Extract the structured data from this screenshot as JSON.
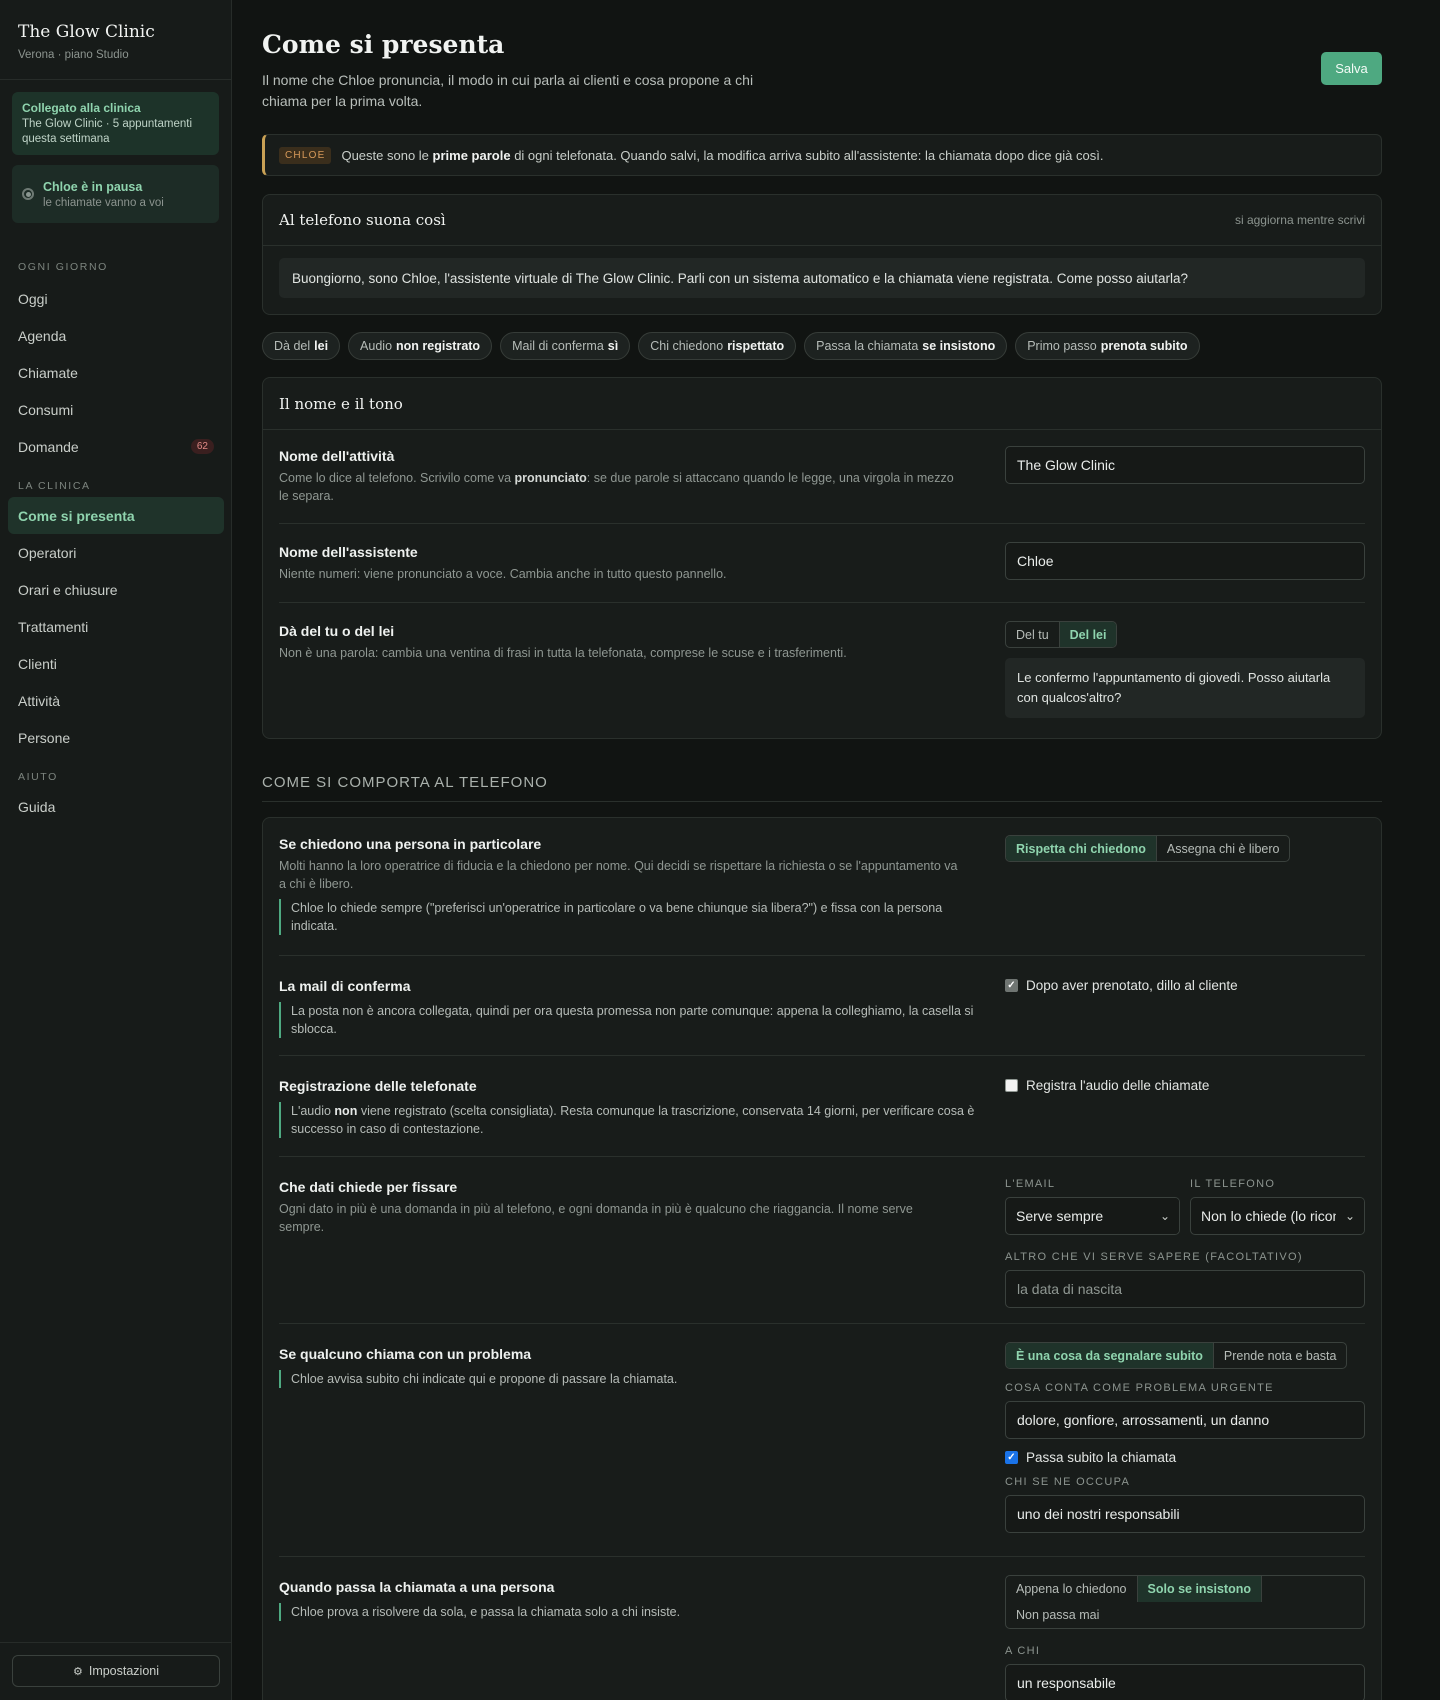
{
  "sidebar": {
    "brand": "The Glow Clinic",
    "location": "Verona · piano Studio",
    "connected": {
      "title": "Collegato alla clinica",
      "text": "The Glow Clinic · 5 appuntamenti questa settimana"
    },
    "pause": {
      "title": "Chloe è in pausa",
      "text": "le chiamate vanno a voi"
    },
    "sections": [
      {
        "label": "Ogni giorno",
        "items": [
          "Oggi",
          "Agenda",
          "Chiamate",
          "Consumi",
          "Domande"
        ]
      },
      {
        "label": "La clinica",
        "items": [
          "Come si presenta",
          "Operatori",
          "Orari e chiusure",
          "Trattamenti",
          "Clienti",
          "Attività",
          "Persone"
        ]
      },
      {
        "label": "Aiuto",
        "items": [
          "Guida"
        ]
      }
    ],
    "domande_badge": "62",
    "settings": "Impostazioni"
  },
  "header": {
    "title": "Come si presenta",
    "subtitle": "Il nome che Chloe pronuncia, il modo in cui parla ai clienti e cosa propone a chi chiama per la prima volta.",
    "save": "Salva"
  },
  "notice": {
    "tag": "CHLOE",
    "pre": "Queste sono le",
    "bold": "prime parole",
    "post": "di ogni telefonata. Quando salvi, la modifica arriva subito all'assistente: la chiamata dopo dice già così."
  },
  "preview": {
    "title": "Al telefono suona così",
    "note": "si aggiorna mentre scrivi",
    "greeting": "Buongiorno, sono Chloe, l'assistente virtuale di The Glow Clinic. Parli con un sistema automatico e la chiamata viene registrata. Come posso aiutarla?"
  },
  "chips": [
    {
      "k": "Dà del",
      "v": "lei"
    },
    {
      "k": "Audio",
      "v": "non registrato"
    },
    {
      "k": "Mail di conferma",
      "v": "sì"
    },
    {
      "k": "Chi chiedono",
      "v": "rispettato"
    },
    {
      "k": "Passa la chiamata",
      "v": "se insistono"
    },
    {
      "k": "Primo passo",
      "v": "prenota subito"
    }
  ],
  "name_panel": {
    "title": "Il nome e il tono",
    "business": {
      "label": "Nome dell'attività",
      "desc_pre": "Come lo dice al telefono. Scrivilo come va",
      "desc_bold": "pronunciato",
      "desc_post": ": se due parole si attaccano quando le legge, una virgola in mezzo le separa.",
      "value": "The Glow Clinic"
    },
    "assistant": {
      "label": "Nome dell'assistente",
      "desc": "Niente numeri: viene pronunciato a voce. Cambia anche in tutto questo pannello.",
      "value": "Chloe"
    },
    "tone": {
      "label": "Dà del tu o del lei",
      "desc": "Non è una parola: cambia una ventina di frasi in tutta la telefonata, comprese le scuse e i trasferimenti.",
      "options": [
        "Del tu",
        "Del lei"
      ],
      "example": "Le confermo l'appuntamento di giovedì. Posso aiutarla con qualcos'altro?"
    }
  },
  "behavior": {
    "section_title": "COME SI COMPORTA AL TELEFONO",
    "person": {
      "label": "Se chiedono una persona in particolare",
      "desc": "Molti hanno la loro operatrice di fiducia e la chiedono per nome. Qui decidi se rispettare la richiesta o se l'appuntamento va a chi è libero.",
      "quote": "Chloe lo chiede sempre (\"preferisci un'operatrice in particolare o va bene chiunque sia libera?\") e fissa con la persona indicata.",
      "options": [
        "Rispetta chi chiedono",
        "Assegna chi è libero"
      ]
    },
    "mail": {
      "label": "La mail di conferma",
      "quote": "La posta non è ancora collegata, quindi per ora questa promessa non parte comunque: appena la colleghiamo, la casella si sblocca.",
      "check": "Dopo aver prenotato, dillo al cliente"
    },
    "recording": {
      "label": "Registrazione delle telefonate",
      "quote_pre": "L'audio",
      "quote_bold": "non",
      "quote_post": "viene registrato (scelta consigliata). Resta comunque la trascrizione, conservata 14 giorni, per verificare cosa è successo in caso di contestazione.",
      "check": "Registra l'audio delle chiamate"
    },
    "data": {
      "label": "Che dati chiede per fissare",
      "desc": "Ogni dato in più è una domanda in più al telefono, e ogni domanda in più è qualcuno che riaggancia. Il nome serve sempre.",
      "email_label": "L'email",
      "email_value": "Serve sempre",
      "phone_label": "Il telefono",
      "phone_value": "Non lo chiede (lo riconosce dal numero)",
      "extra_label": "Altro che vi serve sapere (facoltativo)",
      "extra_placeholder": "la data di nascita"
    },
    "problem": {
      "label": "Se qualcuno chiama con un problema",
      "quote": "Chloe avvisa subito chi indicate qui e propone di passare la chiamata.",
      "options": [
        "È una cosa da segnalare subito",
        "Prende nota e basta"
      ],
      "urgent_label": "Cosa conta come problema urgente",
      "urgent_value": "dolore, gonfiore, arrossamenti, un danno",
      "check": "Passa subito la chiamata",
      "who_label": "Chi se ne occupa",
      "who_value": "uno dei nostri responsabili"
    },
    "transfer": {
      "label": "Quando passa la chiamata a una persona",
      "quote": "Chloe prova a risolvere da sola, e passa la chiamata solo a chi insiste.",
      "options": [
        "Appena lo chiedono",
        "Solo se insistono",
        "Non passa mai"
      ],
      "to_label": "A chi",
      "to_value": "un responsabile"
    }
  }
}
